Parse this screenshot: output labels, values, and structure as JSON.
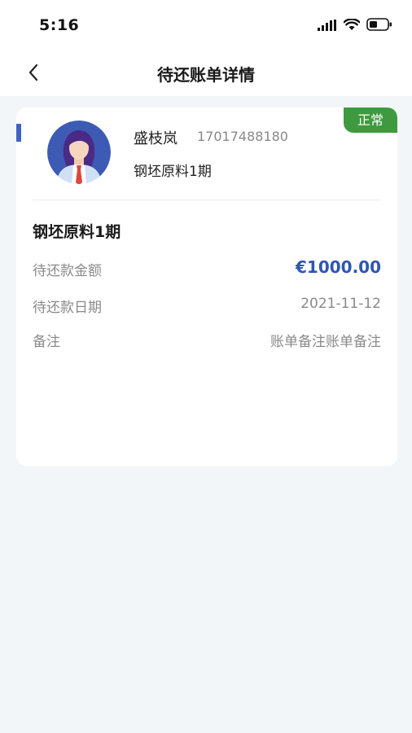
{
  "status_bar": {
    "time": "5:16"
  },
  "header": {
    "title": "待还账单详情"
  },
  "card": {
    "status_badge": "正常",
    "user": {
      "name": "盛枝岚",
      "phone": "17017488180",
      "product": "钢坯原料1期"
    },
    "section_title": "钢坯原料1期",
    "rows": [
      {
        "label": "待还款金额",
        "value": "€1000.00"
      },
      {
        "label": "待还款日期",
        "value": "2021-11-12"
      },
      {
        "label": "备注",
        "value": "账单备注账单备注"
      }
    ]
  },
  "colors": {
    "accent": "#3f63c4",
    "amount": "#2f56b0",
    "badge": "#3f9a3f",
    "background": "#f3f6f8"
  },
  "icons": [
    "signal-icon",
    "wifi-icon",
    "battery-icon",
    "back-arrow-icon"
  ]
}
